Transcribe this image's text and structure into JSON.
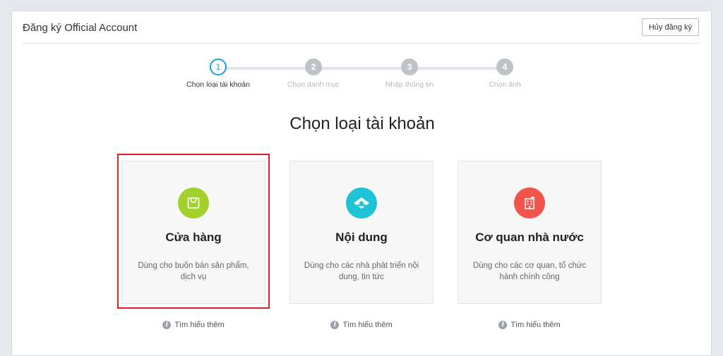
{
  "header": {
    "title": "Đăng ký Official Account",
    "cancel_label": "Hủy đăng ký"
  },
  "stepper": {
    "steps": [
      {
        "number": "1",
        "label": "Chọn loại tài khoản",
        "active": true
      },
      {
        "number": "2",
        "label": "Chọn danh mục",
        "active": false
      },
      {
        "number": "3",
        "label": "Nhập thông tin",
        "active": false
      },
      {
        "number": "4",
        "label": "Chọn ảnh",
        "active": false
      }
    ]
  },
  "main": {
    "title": "Chọn loại tài khoản",
    "cards": [
      {
        "title": "Cửa hàng",
        "desc": "Dùng cho buôn bán sản phẩm, dịch vụ",
        "icon": "shopping-bag-icon",
        "color": "#a2d12c",
        "selected": true
      },
      {
        "title": "Nội dung",
        "desc": "Dùng cho các nhà phát triển nội dung, tin tức",
        "icon": "content-icon",
        "color": "#1fc3d8",
        "selected": false
      },
      {
        "title": "Cơ quan nhà nước",
        "desc": "Dùng cho các cơ quan, tổ chức hành chính công",
        "icon": "building-icon",
        "color": "#f0544b",
        "selected": false
      }
    ],
    "learn_more_label": "Tìm hiểu thêm"
  },
  "colors": {
    "accent": "#1aa0e8",
    "selection": "#e01e26"
  }
}
